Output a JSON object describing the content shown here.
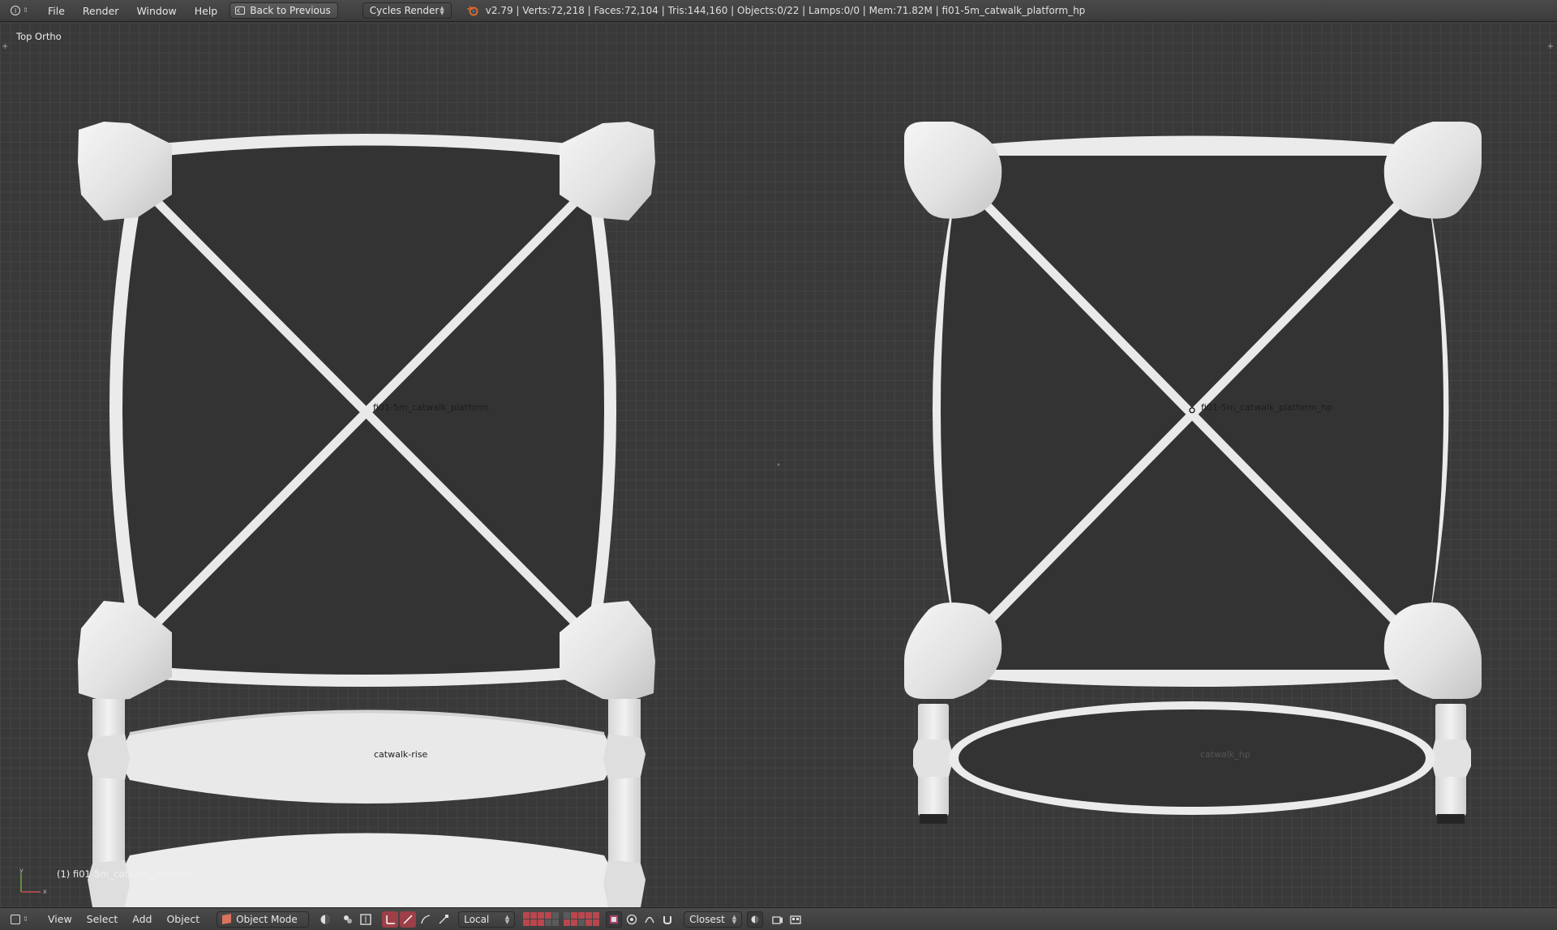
{
  "header": {
    "menus": [
      "File",
      "Render",
      "Window",
      "Help"
    ],
    "back_button": "Back to Previous",
    "render_engine": "Cycles Render",
    "stats": "v2.79 | Verts:72,218 | Faces:72,104 | Tris:144,160 | Objects:0/22 | Lamps:0/0 | Mem:71.82M | fi01-5m_catwalk_platform_hp"
  },
  "viewport": {
    "view_name": "Top Ortho",
    "active_object_label": "(1) fi01-5m_catwalk_platform",
    "axis_x": "x",
    "axis_y": "y",
    "objects": [
      {
        "label": "fi01-5m_catwalk_platform"
      },
      {
        "label": "catwalk-rise"
      },
      {
        "label": "fi01-5m_catwalk_platform_hp"
      },
      {
        "label": "catwalk_hp"
      }
    ]
  },
  "footer": {
    "menus": [
      "View",
      "Select",
      "Add",
      "Object"
    ],
    "mode": "Object Mode",
    "orientation": "Local",
    "snap_target": "Closest"
  },
  "colors": {
    "background": "#393939",
    "grid": "#434343",
    "mesh": "#ebebeb",
    "mesh_shadow": "#c6c6c6",
    "panel": "#333333",
    "accent_red": "#9c3f47"
  }
}
